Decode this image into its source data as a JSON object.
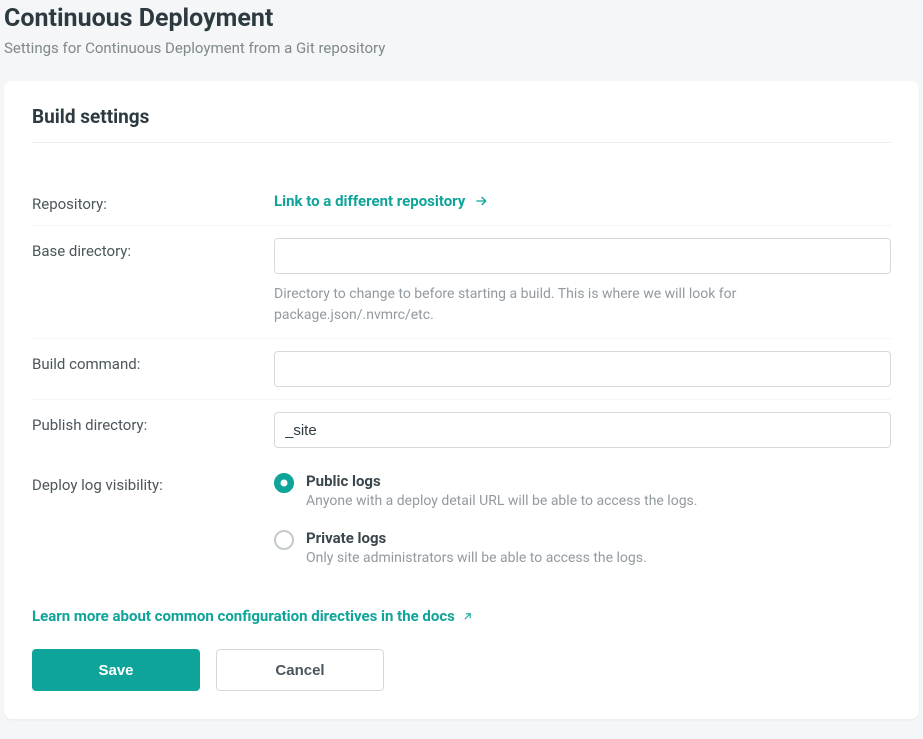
{
  "header": {
    "title": "Continuous Deployment",
    "subtitle": "Settings for Continuous Deployment from a Git repository"
  },
  "card": {
    "title": "Build settings"
  },
  "form": {
    "repository": {
      "label": "Repository:",
      "link_text": "Link to a different repository"
    },
    "base_directory": {
      "label": "Base directory:",
      "value": "",
      "help": "Directory to change to before starting a build. This is where we will look for package.json/.nvmrc/etc."
    },
    "build_command": {
      "label": "Build command:",
      "value": ""
    },
    "publish_directory": {
      "label": "Publish directory:",
      "value": "_site"
    },
    "log_visibility": {
      "label": "Deploy log visibility:",
      "options": [
        {
          "title": "Public logs",
          "desc": "Anyone with a deploy detail URL will be able to access the logs.",
          "selected": true
        },
        {
          "title": "Private logs",
          "desc": "Only site administrators will be able to access the logs.",
          "selected": false
        }
      ]
    }
  },
  "docs": {
    "link_text": "Learn more about common configuration directives in the docs"
  },
  "actions": {
    "save": "Save",
    "cancel": "Cancel"
  }
}
